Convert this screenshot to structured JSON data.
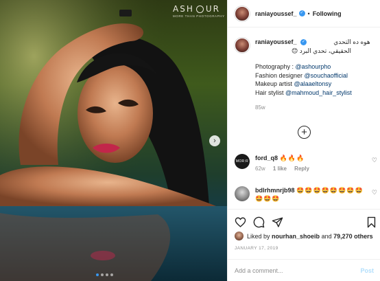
{
  "watermark": {
    "brand_left": "ASH",
    "brand_right": "UR",
    "tagline": "MORE THAN PHOTOGRAPHY"
  },
  "photo": {
    "carousel_dot_count": 4,
    "active_dot": 0,
    "next_icon": "chevron-right-icon"
  },
  "header": {
    "username": "raniayoussef_",
    "separator": "•",
    "follow_label": "Following"
  },
  "caption": {
    "username": "raniayoussef_",
    "arabic_line1": "هوه ده التحدي",
    "arabic_line2": "الحقيقي، تحدي البرد 😊",
    "credits": [
      {
        "label": "Photography : ",
        "handle": "@ashourpho"
      },
      {
        "label": "Fashion designer ",
        "handle": "@souchaofficial"
      },
      {
        "label": "Makeup artist ",
        "handle": "@alaaeltonsy"
      },
      {
        "label": "Hair stylist ",
        "handle": "@mahmoud_hair_stylist"
      }
    ],
    "time": "85w"
  },
  "load_more_icon": "plus-circle-icon",
  "comments": [
    {
      "username": "ford_q8",
      "text": "🔥🔥🔥",
      "avatar_text": "MOR:R",
      "time": "62w",
      "likes": "1 like",
      "reply": "Reply"
    },
    {
      "username": "bdlrhmnrjb98",
      "text": "🤩🤩🤩🤩🤩🤩🤩🤩🤩🤩🤩",
      "time": "",
      "likes": "",
      "reply": ""
    }
  ],
  "actions": {
    "like_icon": "heart-icon",
    "comment_icon": "comment-icon",
    "share_icon": "paper-plane-icon",
    "save_icon": "bookmark-icon"
  },
  "likes": {
    "prefix": "Liked by ",
    "user": "nourhan_shoeib",
    "middle": " and ",
    "count": "79,270 others"
  },
  "date": "JANUARY 17, 2019",
  "add_comment": {
    "placeholder": "Add a comment...",
    "post_label": "Post"
  },
  "colors": {
    "link": "#00376b",
    "verified": "#3897f0",
    "post_disabled": "#b2dffc",
    "muted": "#8e8e8e"
  }
}
